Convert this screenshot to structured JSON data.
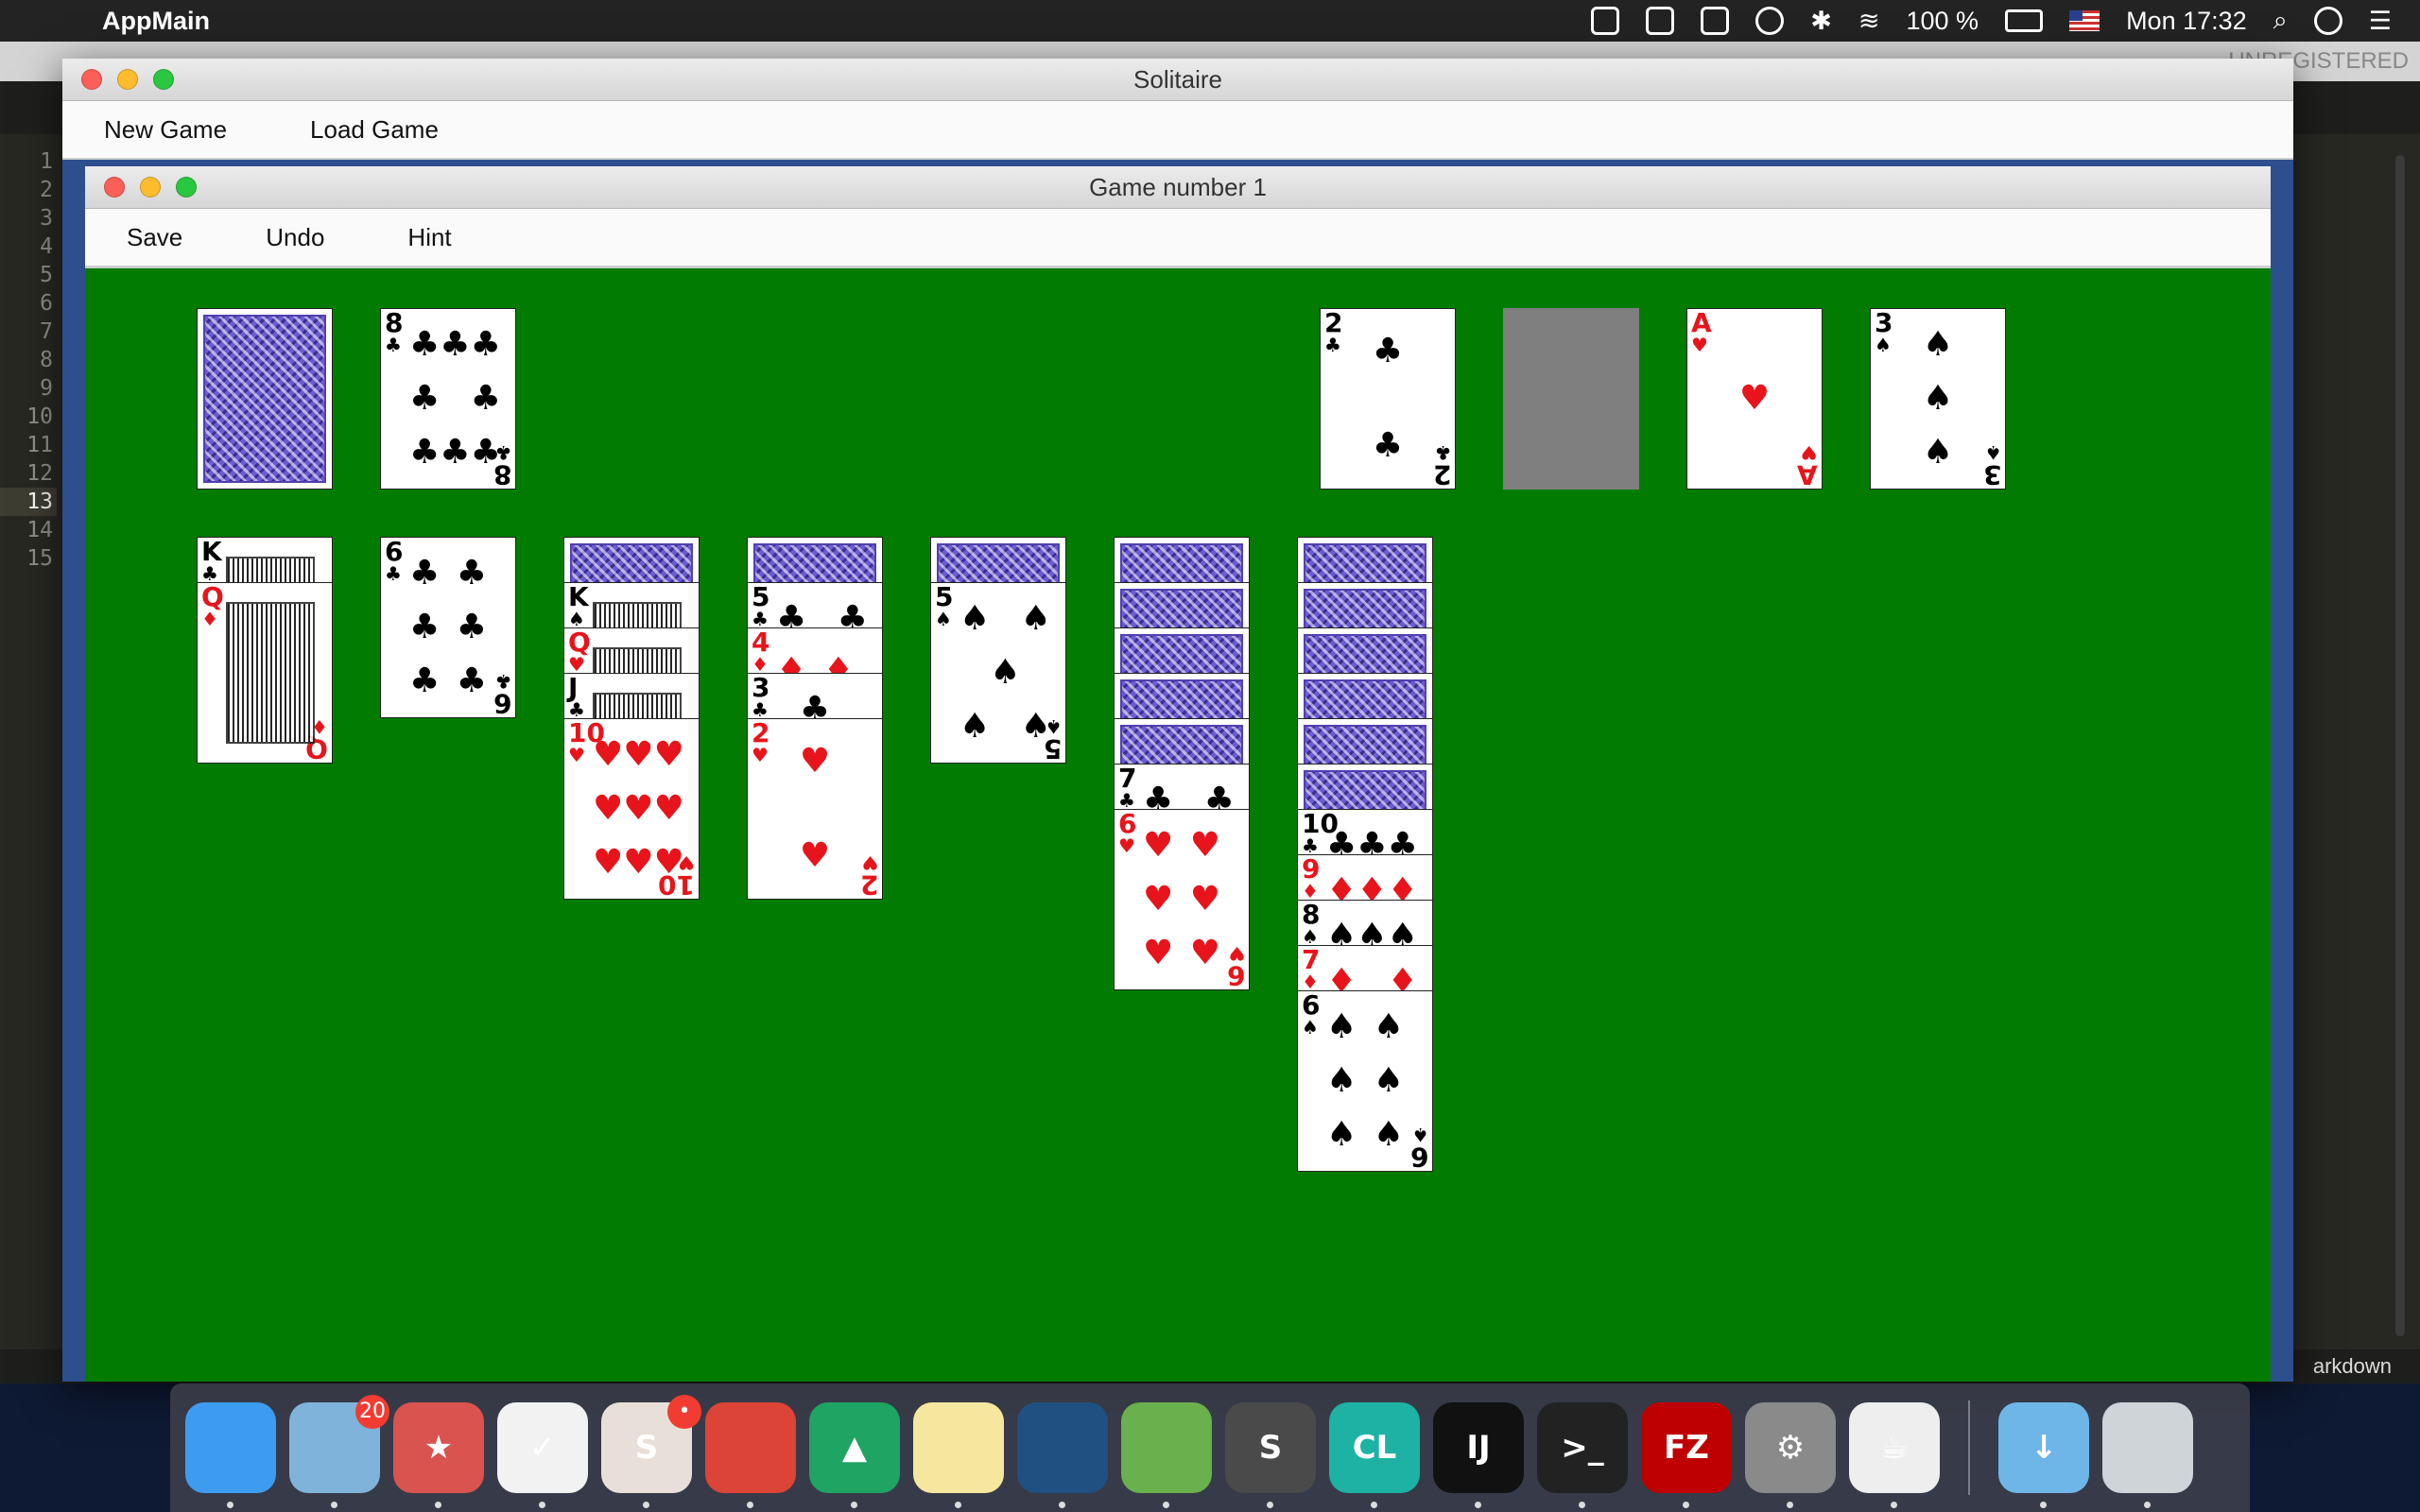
{
  "menubar": {
    "app_name": "AppMain",
    "battery": "100 %",
    "clock": "Mon 17:32"
  },
  "editor": {
    "unregistered": "UNREGISTERED",
    "status_right": "arkdown",
    "line_numbers": [
      "1",
      "2",
      "3",
      "4",
      "5",
      "6",
      "7",
      "8",
      "9",
      "10",
      "11",
      "12",
      "13",
      "14",
      "15"
    ],
    "current_line": "13"
  },
  "solitaire_window": {
    "title": "Solitaire",
    "menu": {
      "new_game": "New Game",
      "load_game": "Load Game"
    }
  },
  "game_window": {
    "title": "Game number 1",
    "menu": {
      "save": "Save",
      "undo": "Undo",
      "hint": "Hint"
    }
  },
  "colors": {
    "felt": "#017c00",
    "card_red": "#e8141b",
    "card_black": "#000000",
    "card_back": "#6b5bd6"
  },
  "game": {
    "stock": {
      "state": "face-down"
    },
    "waste": {
      "rank": "8",
      "suit": "♣"
    },
    "foundations": [
      {
        "rank": "2",
        "suit": "♣"
      },
      {
        "rank": "",
        "suit": "",
        "state": "empty"
      },
      {
        "rank": "A",
        "suit": "♥"
      },
      {
        "rank": "3",
        "suit": "♠"
      }
    ],
    "tableau": [
      {
        "face_down": 0,
        "face_up": [
          {
            "rank": "K",
            "suit": "♣"
          },
          {
            "rank": "Q",
            "suit": "♦"
          }
        ]
      },
      {
        "face_down": 0,
        "face_up": [
          {
            "rank": "6",
            "suit": "♣"
          }
        ]
      },
      {
        "face_down": 1,
        "face_up": [
          {
            "rank": "K",
            "suit": "♠"
          },
          {
            "rank": "Q",
            "suit": "♥"
          },
          {
            "rank": "J",
            "suit": "♣"
          },
          {
            "rank": "10",
            "suit": "♥"
          }
        ]
      },
      {
        "face_down": 1,
        "face_up": [
          {
            "rank": "5",
            "suit": "♣"
          },
          {
            "rank": "4",
            "suit": "♦"
          },
          {
            "rank": "3",
            "suit": "♣"
          },
          {
            "rank": "2",
            "suit": "♥"
          }
        ]
      },
      {
        "face_down": 1,
        "face_up": [
          {
            "rank": "5",
            "suit": "♠"
          }
        ]
      },
      {
        "face_down": 5,
        "face_up": [
          {
            "rank": "7",
            "suit": "♣"
          },
          {
            "rank": "6",
            "suit": "♥"
          }
        ]
      },
      {
        "face_down": 6,
        "face_up": [
          {
            "rank": "10",
            "suit": "♣"
          },
          {
            "rank": "9",
            "suit": "♦"
          },
          {
            "rank": "8",
            "suit": "♠"
          },
          {
            "rank": "7",
            "suit": "♦"
          },
          {
            "rank": "6",
            "suit": "♠"
          }
        ]
      }
    ]
  },
  "dock": {
    "apps": [
      {
        "name": "finder-icon",
        "label": "",
        "color": "#3d9cf0"
      },
      {
        "name": "mail-icon",
        "label": "",
        "color": "#7fb3d9",
        "badge": "20"
      },
      {
        "name": "wunderlist-icon",
        "label": "★",
        "color": "#d9534f"
      },
      {
        "name": "things-icon",
        "label": "✓",
        "color": "#f2f2f2"
      },
      {
        "name": "slack-icon",
        "label": "S",
        "color": "#e8e0d8",
        "badge": "•"
      },
      {
        "name": "chrome-icon",
        "label": "",
        "color": "#db4437"
      },
      {
        "name": "drive-icon",
        "label": "▲",
        "color": "#1fa463"
      },
      {
        "name": "notes-icon",
        "label": "",
        "color": "#f5e79e"
      },
      {
        "name": "sourcetree-icon",
        "label": "",
        "color": "#205081"
      },
      {
        "name": "android-studio-icon",
        "label": "",
        "color": "#6ab04c"
      },
      {
        "name": "sublime-icon",
        "label": "S",
        "color": "#4a4a4a"
      },
      {
        "name": "clion-icon",
        "label": "CL",
        "color": "#1db2a4"
      },
      {
        "name": "intellij-icon",
        "label": "IJ",
        "color": "#111111"
      },
      {
        "name": "terminal-icon",
        "label": ">_",
        "color": "#222222"
      },
      {
        "name": "filezilla-icon",
        "label": "FZ",
        "color": "#bf0000"
      },
      {
        "name": "system-preferences-icon",
        "label": "⚙",
        "color": "#8a8a8a"
      },
      {
        "name": "java-icon",
        "label": "☕",
        "color": "#eeeeee"
      },
      {
        "name": "downloads-folder-icon",
        "label": "↓",
        "color": "#6fb6e8"
      },
      {
        "name": "trash-icon",
        "label": "",
        "color": "#cfd4d8"
      }
    ]
  }
}
